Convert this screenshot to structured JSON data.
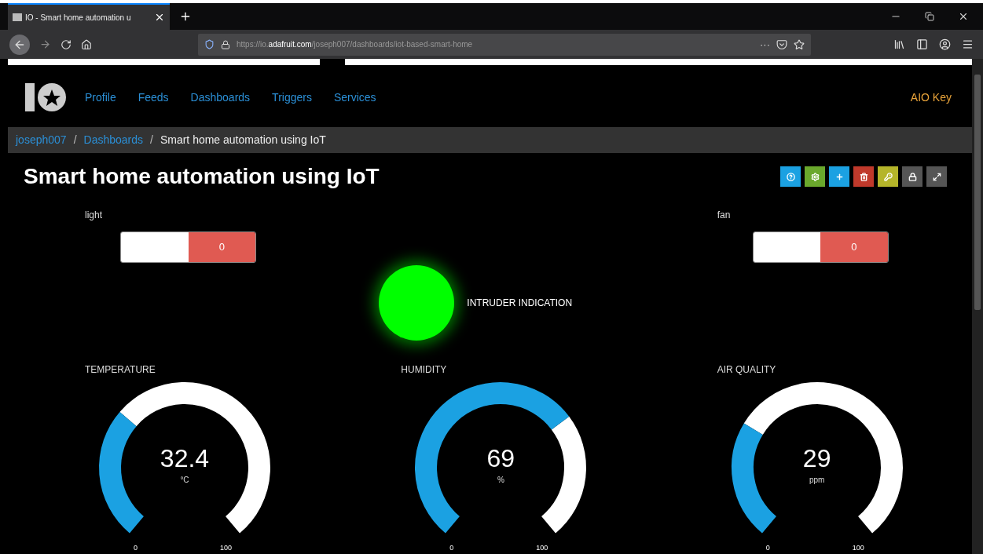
{
  "browser": {
    "tab_title": "IO - Smart home automation u",
    "url_prefix": "https://io.",
    "url_domain": "adafruit.com",
    "url_path": "/joseph007/dashboards/iot-based-smart-home",
    "page_actions": "···"
  },
  "nav": {
    "links": [
      "Profile",
      "Feeds",
      "Dashboards",
      "Triggers",
      "Services"
    ],
    "aio_key": "AIO Key"
  },
  "breadcrumb": {
    "links": [
      "joseph007",
      "Dashboards"
    ],
    "separators": [
      "/",
      "/"
    ],
    "current": "Smart home automation using IoT"
  },
  "title": "Smart home automation using IoT",
  "toolbar": [
    {
      "kind": "help",
      "color": "#1ba1e2"
    },
    {
      "kind": "settings",
      "color": "#6aa82c"
    },
    {
      "kind": "add",
      "color": "#1ba1e2"
    },
    {
      "kind": "delete",
      "color": "#c0392b"
    },
    {
      "kind": "key",
      "color": "#b5b52a"
    },
    {
      "kind": "lock",
      "color": "#555555"
    },
    {
      "kind": "expand",
      "color": "#555555"
    }
  ],
  "blocks": [
    {
      "kind": "toggle",
      "label": "light",
      "on": false,
      "value": "0"
    },
    {
      "kind": "indicator",
      "on": true,
      "label": "INTRUDER INDICATION"
    },
    {
      "kind": "toggle",
      "label": "fan",
      "on": false,
      "value": "0"
    }
  ],
  "gauges": [
    {
      "label": "TEMPERATURE",
      "value": "32.4",
      "unit": "°C",
      "min": "0",
      "max": "100"
    },
    {
      "label": "HUMIDITY",
      "value": "69",
      "unit": "%",
      "min": "0",
      "max": "100"
    },
    {
      "label": "AIR QUALITY",
      "value": "29",
      "unit": "ppm",
      "min": "0",
      "max": "100"
    }
  ]
}
